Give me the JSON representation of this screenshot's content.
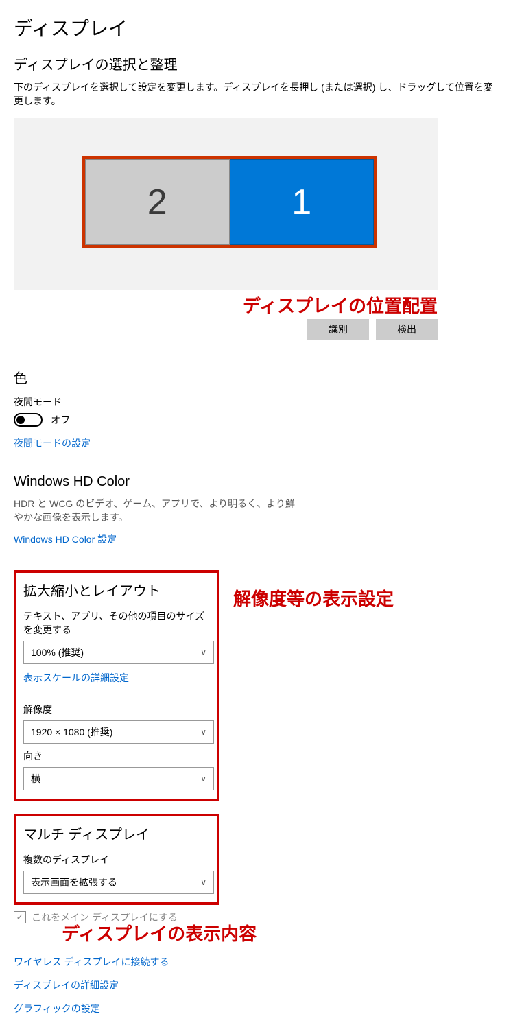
{
  "page": {
    "title": "ディスプレイ"
  },
  "arrangement": {
    "heading": "ディスプレイの選択と整理",
    "description": "下のディスプレイを選択して設定を変更します。ディスプレイを長押し (または選択) し、ドラッグして位置を変更します。",
    "monitor2_label": "2",
    "monitor1_label": "1",
    "identify_btn": "識別",
    "detect_btn": "検出",
    "annotation": "ディスプレイの位置配置"
  },
  "color": {
    "heading": "色",
    "night_mode_label": "夜間モード",
    "night_mode_state": "オフ",
    "night_mode_link": "夜間モードの設定"
  },
  "hdcolor": {
    "heading": "Windows HD Color",
    "description": "HDR と WCG のビデオ、ゲーム、アプリで、より明るく、より鮮やかな画像を表示します。",
    "link": "Windows HD Color 設定"
  },
  "scale": {
    "heading": "拡大縮小とレイアウト",
    "text_size_label": "テキスト、アプリ、その他の項目のサイズを変更する",
    "text_size_value": "100% (推奨)",
    "advanced_scale_link": "表示スケールの詳細設定",
    "resolution_label": "解像度",
    "resolution_value": "1920 × 1080 (推奨)",
    "orientation_label": "向き",
    "orientation_value": "横",
    "annotation": "解像度等の表示設定"
  },
  "multi": {
    "heading": "マルチ ディスプレイ",
    "multiple_label": "複数のディスプレイ",
    "multiple_value": "表示画面を拡張する",
    "main_display_checkbox": "これをメイン ディスプレイにする",
    "annotation": "ディスプレイの表示内容",
    "wireless_link": "ワイヤレス ディスプレイに接続する",
    "advanced_link": "ディスプレイの詳細設定",
    "graphics_link": "グラフィックの設定"
  }
}
